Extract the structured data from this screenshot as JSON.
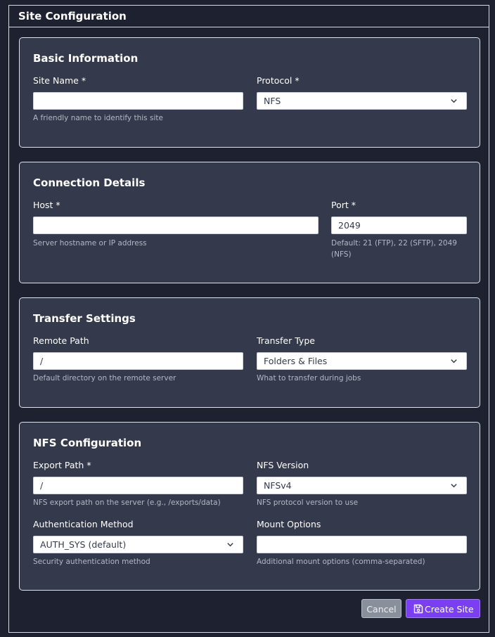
{
  "window": {
    "title": "Site Configuration"
  },
  "sections": {
    "basic": {
      "title": "Basic Information",
      "site_name": {
        "label": "Site Name *",
        "value": "",
        "help": "A friendly name to identify this site"
      },
      "protocol": {
        "label": "Protocol *",
        "value": "NFS"
      }
    },
    "connection": {
      "title": "Connection Details",
      "host": {
        "label": "Host *",
        "value": "",
        "help": "Server hostname or IP address"
      },
      "port": {
        "label": "Port *",
        "value": "2049",
        "help_line1": "Default: 21 (FTP), 22 (SFTP), 2049",
        "help_line2": "(NFS)"
      }
    },
    "transfer": {
      "title": "Transfer Settings",
      "remote_path": {
        "label": "Remote Path",
        "value": "/",
        "help": "Default directory on the remote server"
      },
      "transfer_type": {
        "label": "Transfer Type",
        "value": "Folders & Files",
        "help": "What to transfer during jobs"
      }
    },
    "nfs": {
      "title": "NFS Configuration",
      "export_path": {
        "label": "Export Path *",
        "value": "/",
        "help": "NFS export path on the server (e.g., /exports/data)"
      },
      "nfs_version": {
        "label": "NFS Version",
        "value": "NFSv4",
        "help": "NFS protocol version to use"
      },
      "auth_method": {
        "label": "Authentication Method",
        "value": "AUTH_SYS (default)",
        "help": "Security authentication method"
      },
      "mount_options": {
        "label": "Mount Options",
        "value": "",
        "help": "Additional mount options (comma-separated)"
      }
    }
  },
  "actions": {
    "cancel": "Cancel",
    "create": "Create Site"
  },
  "icons": {
    "select_arrow": "chevron-down-icon",
    "create": "save-icon"
  },
  "colors": {
    "background": "#1e2230",
    "card": "#343a4b",
    "primary": "#7b3ff2",
    "cancel": "#8a8f9c"
  }
}
